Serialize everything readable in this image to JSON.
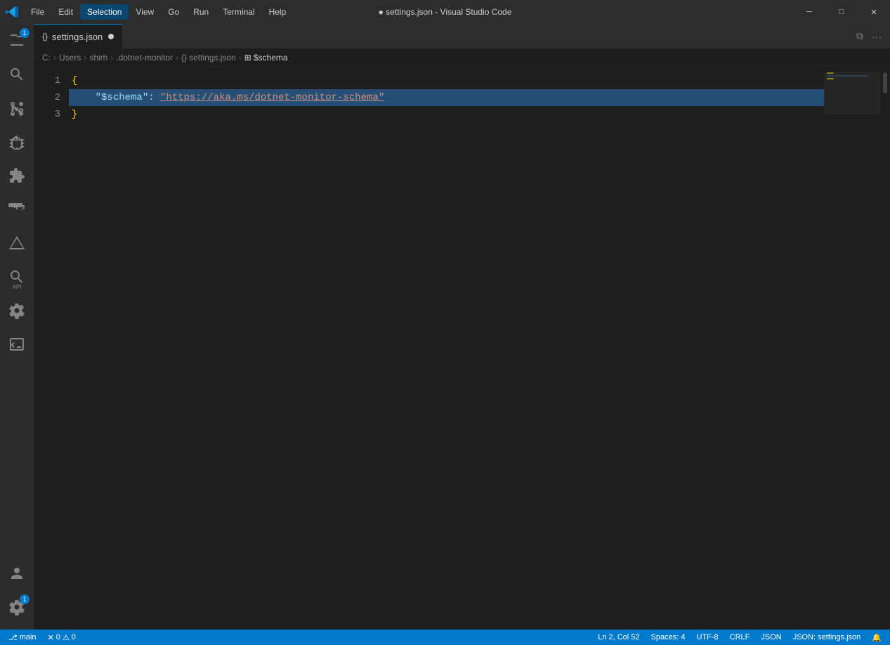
{
  "window": {
    "title": "● settings.json - Visual Studio Code"
  },
  "menu": {
    "items": [
      "File",
      "Edit",
      "Selection",
      "View",
      "Go",
      "Run",
      "Terminal",
      "Help"
    ]
  },
  "window_controls": {
    "minimize": "─",
    "maximize": "□",
    "close": "✕"
  },
  "tab": {
    "icon": "{}",
    "name": "settings.json",
    "modified": true,
    "modified_dot": "●"
  },
  "breadcrumb": {
    "items": [
      "C:",
      "Users",
      "shirh",
      ".dotnet-monitor",
      "{} settings.json",
      "⊞ $schema"
    ],
    "separator": "›"
  },
  "editor": {
    "lines": [
      {
        "number": "1",
        "content": "{",
        "type": "brace-open"
      },
      {
        "number": "2",
        "content": "    \"$schema\": \"https://aka.ms/dotnet-monitor-schema\"",
        "type": "key-value",
        "selected": true
      },
      {
        "number": "3",
        "content": "}",
        "type": "brace-close"
      }
    ]
  },
  "code": {
    "line1": "{",
    "line2_key": "\"$schema\"",
    "line2_colon": ": ",
    "line2_value": "\"https://aka.ms/dotnet-monitor-schema\"",
    "line3": "}"
  },
  "status": {
    "branch": "main",
    "errors": "0",
    "warnings": "0",
    "line_col": "Ln 2, Col 52",
    "spaces": "Spaces: 4",
    "encoding": "UTF-8",
    "line_ending": "CRLF",
    "language": "JSON",
    "schema": "JSON: settings.json"
  }
}
